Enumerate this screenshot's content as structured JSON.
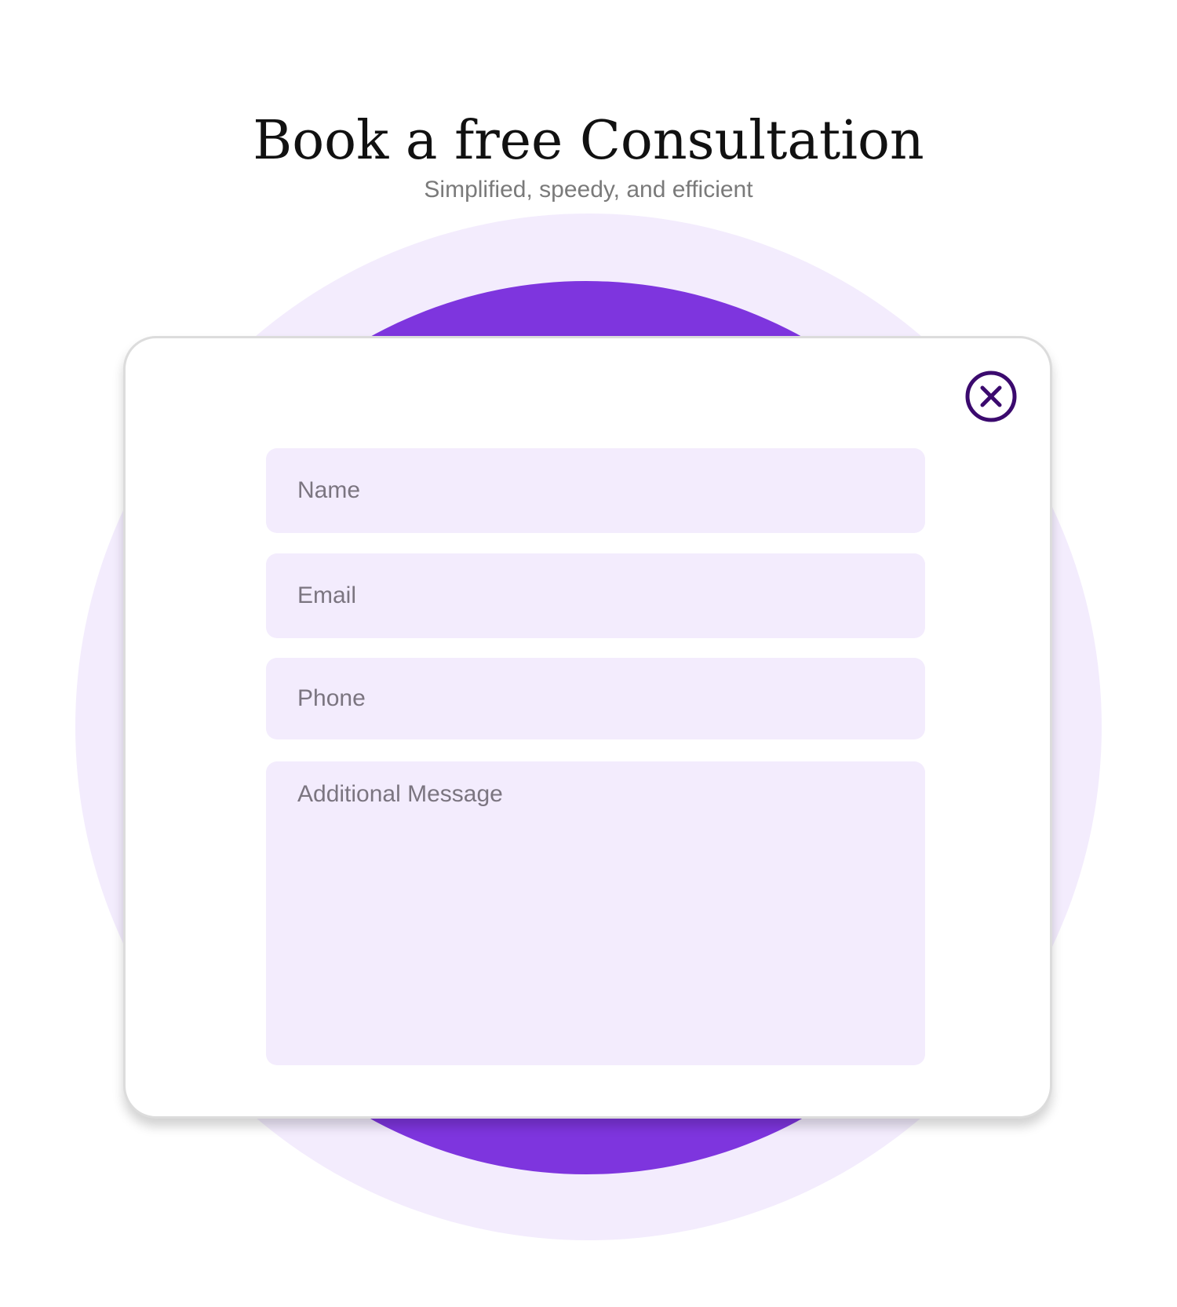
{
  "header": {
    "title": "Book a free Consultation",
    "subtitle": "Simplified, speedy, and efficient"
  },
  "form": {
    "name_placeholder": "Name",
    "email_placeholder": "Email",
    "phone_placeholder": "Phone",
    "message_placeholder": "Additional Message",
    "close_icon": "close-circle-icon"
  },
  "colors": {
    "accent": "#7e35de",
    "accent_light": "#f3ecfd",
    "close_icon": "#3b0a6e",
    "title_text": "#111111",
    "subtitle_text": "#7a7a7a",
    "placeholder_text": "#7b7580"
  }
}
